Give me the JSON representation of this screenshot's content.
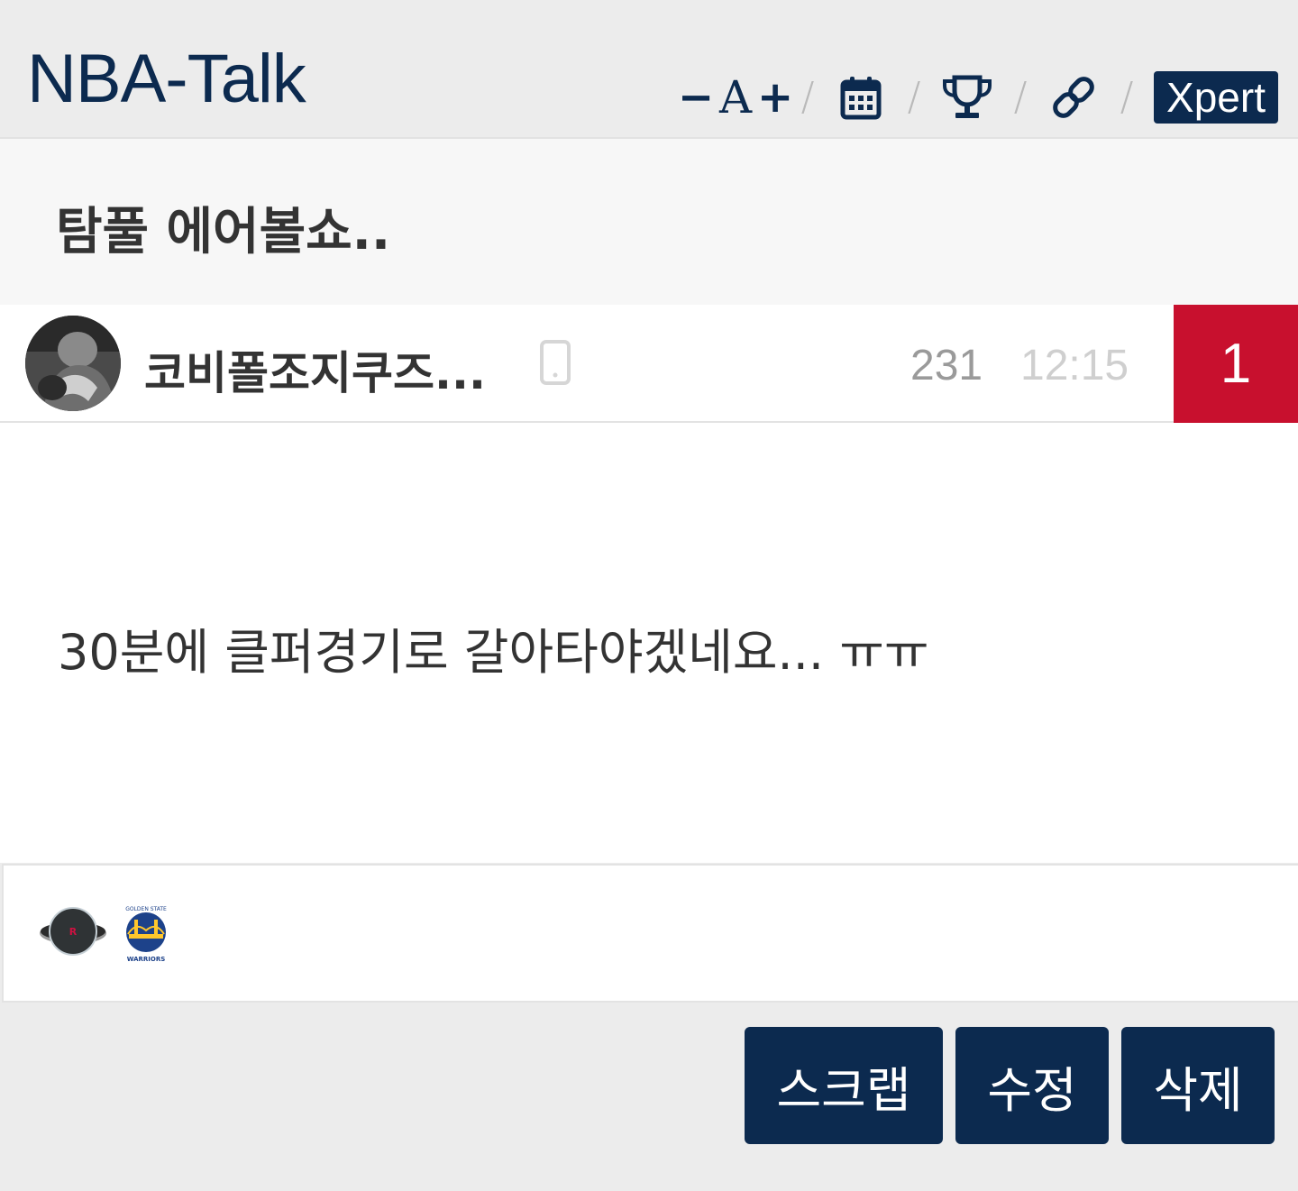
{
  "header": {
    "app_title": "NBA-Talk",
    "font_minus": "−",
    "font_label": "A",
    "font_plus": "+",
    "separator": "/",
    "xpert_label": "Xpert",
    "icons": [
      "calendar-icon",
      "trophy-icon",
      "link-icon"
    ]
  },
  "post": {
    "title": "탐풀 에어볼쇼..",
    "author": "코비폴조지쿠즈...",
    "views": "231",
    "time": "12:15",
    "comment_count": "1",
    "body": "30분에 클퍼경기로 갈아타야겠네요... ㅠㅠ"
  },
  "teams": {
    "logos": [
      "houston-rockets-logo",
      "golden-state-warriors-logo"
    ],
    "rockets_ring_text": "HOUSTON ROCKETS",
    "warriors_top_text": "GOLDEN STATE",
    "warriors_bottom_text": "WARRIORS"
  },
  "actions": {
    "scrap": "스크랩",
    "edit": "수정",
    "delete": "삭제"
  },
  "colors": {
    "navy": "#0c2a4f",
    "red": "#c8102e",
    "background": "#ececec"
  }
}
